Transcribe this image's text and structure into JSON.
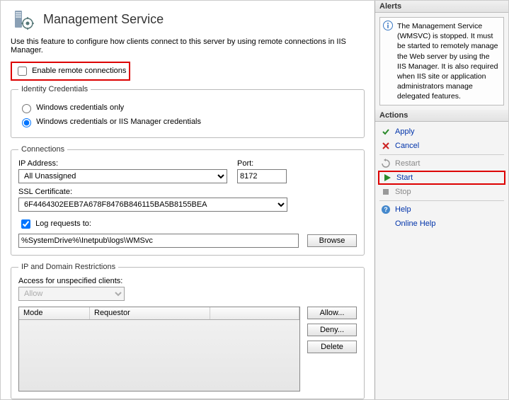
{
  "header": {
    "title": "Management Service"
  },
  "description": "Use this feature to configure how clients connect to this server by using remote connections in IIS Manager.",
  "enableRemote": {
    "label": "Enable remote connections"
  },
  "identity": {
    "legend": "Identity Credentials",
    "opt1": "Windows credentials only",
    "opt2": "Windows credentials or IIS Manager credentials"
  },
  "connections": {
    "legend": "Connections",
    "ipLabel": "IP Address:",
    "ipValue": "All Unassigned",
    "portLabel": "Port:",
    "portValue": "8172",
    "sslLabel": "SSL Certificate:",
    "sslValue": "6F4464302EEB7A678F8476B846115BA5B8155BEA",
    "logLabel": "Log requests to:",
    "logValue": "%SystemDrive%\\Inetpub\\logs\\WMSvc",
    "browse": "Browse"
  },
  "restrictions": {
    "legend": "IP and Domain Restrictions",
    "accessLabel": "Access for unspecified clients:",
    "accessValue": "Allow",
    "colMode": "Mode",
    "colReq": "Requestor",
    "btnAllow": "Allow...",
    "btnDeny": "Deny...",
    "btnDelete": "Delete"
  },
  "alerts": {
    "title": "Alerts",
    "text": "The Management Service (WMSVC) is stopped. It must be started to remotely manage the Web server by using the IIS Manager. It is also required when IIS site or application administrators manage delegated features."
  },
  "actions": {
    "title": "Actions",
    "apply": "Apply",
    "cancel": "Cancel",
    "restart": "Restart",
    "start": "Start",
    "stop": "Stop",
    "help": "Help",
    "onlineHelp": "Online Help"
  }
}
